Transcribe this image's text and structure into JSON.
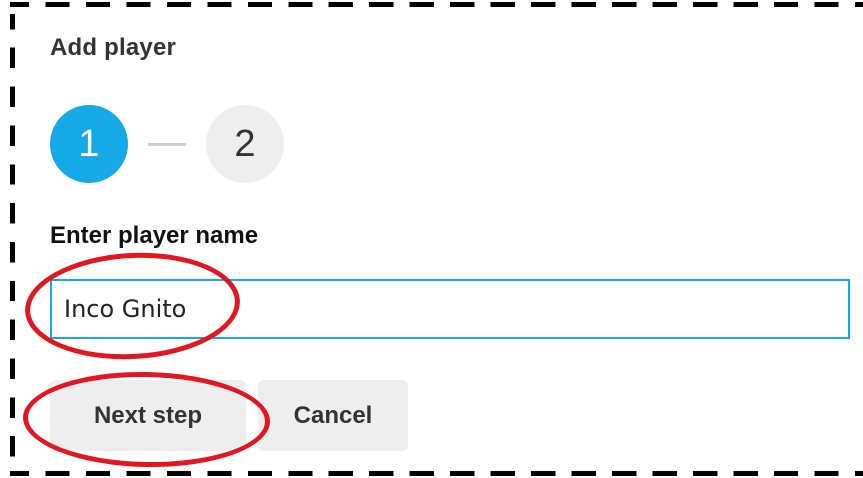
{
  "dialog": {
    "title": "Add player",
    "steps": [
      {
        "label": "1",
        "state": "active"
      },
      {
        "label": "2",
        "state": "inactive"
      }
    ],
    "field_label": "Enter player name",
    "name_value": "Inco Gnito",
    "next_button_label": "Next step",
    "cancel_button_label": "Cancel"
  },
  "colors": {
    "accent": "#16a9e7",
    "annotation": "#e3161f",
    "button_bg": "#eeeeee"
  },
  "annotations": [
    "red-oval-around-input",
    "red-oval-around-next-button"
  ]
}
